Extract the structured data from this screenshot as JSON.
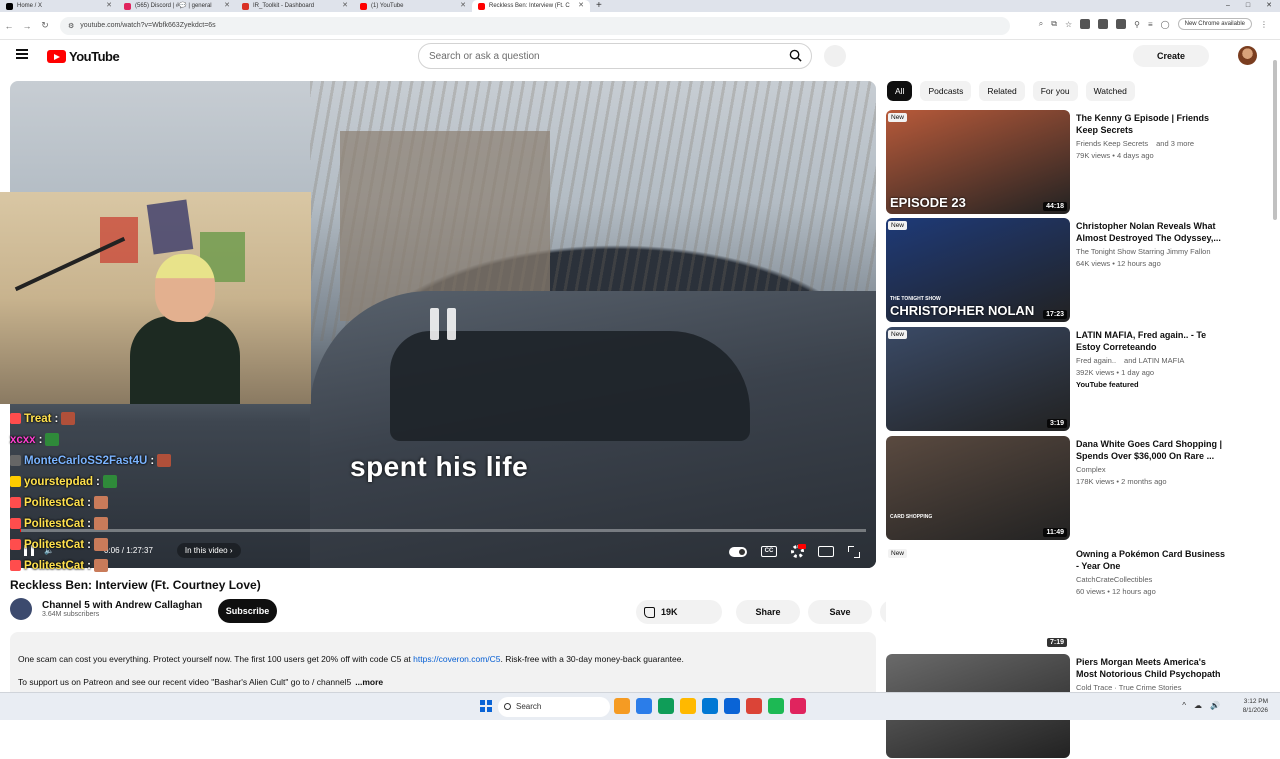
{
  "browser": {
    "tabs": [
      {
        "title": "Home / X",
        "color": "#000000"
      },
      {
        "title": "(565) Discord | #💬 | general",
        "color": "#e0245e"
      },
      {
        "title": "IR_Toolkit - Dashboard",
        "color": "#d93025"
      },
      {
        "title": "(1) YouTube",
        "color": "#ff0000"
      },
      {
        "title": "Reckless Ben: Interview (Ft. C",
        "color": "#ff0000",
        "active": true
      }
    ],
    "new_tab": "+",
    "url": "youtube.com/watch?v=Wbfk663Zyekdct=6s",
    "new_chrome": "New Chrome available",
    "window_controls": [
      "–",
      "□",
      "✕"
    ]
  },
  "youtube": {
    "logo_text": "YouTube",
    "search_placeholder": "Search or ask a question",
    "create_label": "Create"
  },
  "player": {
    "caption": "spent his life",
    "time": "0:06 / 1:27:37",
    "chapter": "In this video",
    "progress_fraction": 0.001,
    "cc_label": "CC"
  },
  "chat": [
    {
      "user": "Treat",
      "color": "#ffe14d",
      "badge": "#ff4d4d",
      "emote": "#b0503a"
    },
    {
      "user": "xcxx",
      "color": "#ff3fd2",
      "badge": "",
      "emote": "#2f8a3a"
    },
    {
      "user": "MonteCarloSS2Fast4U",
      "color": "#7bb4ff",
      "badge": "#666666",
      "emote": "#b0503a"
    },
    {
      "user": "yourstepdad",
      "color": "#ffe14d",
      "badge": "#ffcc00",
      "emote": "#2f8a3a"
    },
    {
      "user": "PolitestCat",
      "color": "#ffe14d",
      "badge": "#ff4d4d",
      "emote": "#c97b5a"
    },
    {
      "user": "PolitestCat",
      "color": "#ffe14d",
      "badge": "#ff4d4d",
      "emote": "#c97b5a"
    },
    {
      "user": "PolitestCat",
      "color": "#ffe14d",
      "badge": "#ff4d4d",
      "emote": "#c97b5a"
    },
    {
      "user": "PolitestCat",
      "color": "#ffe14d",
      "badge": "#ff4d4d",
      "emote": "#c97b5a"
    }
  ],
  "video": {
    "title": "Reckless Ben: Interview (Ft. Courtney Love)",
    "channel": "Channel 5 with Andrew Callaghan",
    "subscribers": "3.64M subscribers",
    "subscribe_label": "Subscribe",
    "likes": "19K",
    "share_label": "Share",
    "save_label": "Save",
    "desc_line1_a": "One scam can cost you everything. Protect yourself now. The first 100 users get 20% off with code C5 at ",
    "desc_link": "https://coveron.com/C5",
    "desc_line1_b": ". Risk-free with a 30-day money-back guarantee.",
    "desc_line2": "To support us on Patreon and see our recent video \"Bashar's Alien Cult\" go to  / channel5",
    "desc_more": "...more"
  },
  "sidebar": {
    "chips": [
      "All",
      "Podcasts",
      "Related",
      "For you",
      "Watched"
    ],
    "videos": [
      {
        "title": "The Kenny G Episode | Friends Keep Secrets",
        "channel": "Friends Keep Secrets",
        "extra": "and 3 more",
        "meta": "79K views • 4 days ago",
        "badge": "New",
        "duration": "44:18",
        "thumb_text": "EPISODE 23",
        "thumb_small": "",
        "featured": "",
        "thumb_color": "#b85a3a"
      },
      {
        "title": "Christopher Nolan Reveals What Almost Destroyed The Odyssey,...",
        "channel": "The Tonight Show Starring Jimmy Fallon",
        "extra": "",
        "meta": "64K views • 12 hours ago",
        "badge": "New",
        "duration": "17:23",
        "thumb_text": "CHRISTOPHER NOLAN",
        "thumb_small": "THE TONIGHT SHOW",
        "featured": "",
        "thumb_color": "#1e3a78"
      },
      {
        "title": "LATIN MAFIA, Fred again.. - Te Estoy Correteando",
        "channel": "Fred again..",
        "extra": "and LATIN MAFIA",
        "meta": "392K views • 1 day ago",
        "badge": "New",
        "duration": "3:19",
        "thumb_text": "",
        "thumb_small": "",
        "featured": "YouTube featured",
        "thumb_color": "#3a4a66"
      },
      {
        "title": "Dana White Goes Card Shopping | Spends Over $36,000 On Rare ...",
        "channel": "Complex",
        "extra": "",
        "meta": "178K views • 2 months ago",
        "badge": "",
        "duration": "11:49",
        "thumb_text": "",
        "thumb_small": "CARD SHOPPING",
        "featured": "",
        "thumb_color": "#5a4a40"
      },
      {
        "title": "Owning a Pokémon Card Business - Year One",
        "channel": "CatchCrateCollectibles",
        "extra": "",
        "meta": "60 views • 12 hours ago",
        "badge": "New",
        "duration": "7:19",
        "thumb_text": "",
        "thumb_small": "",
        "featured": "",
        "thumb_color": "#ffffff"
      },
      {
        "title": "Piers Morgan Meets America's Most Notorious Child Psychopath",
        "channel": "Cold Trace · True Crime Stories",
        "extra": "",
        "meta": "",
        "badge": "",
        "duration": "",
        "thumb_text": "",
        "thumb_small": "",
        "featured": "",
        "thumb_color": "#6a6a6a"
      }
    ]
  },
  "taskbar": {
    "search_label": "Search",
    "apps": [
      "#f59b23",
      "#2b7de9",
      "#0f9d58",
      "#ffb900",
      "#0078d4",
      "#0a64d6",
      "#db4437",
      "#1db954",
      "#e0245e"
    ],
    "tray": [
      "^",
      "☁",
      "🔊"
    ],
    "time": "3:12 PM",
    "date": "8/1/2026"
  }
}
